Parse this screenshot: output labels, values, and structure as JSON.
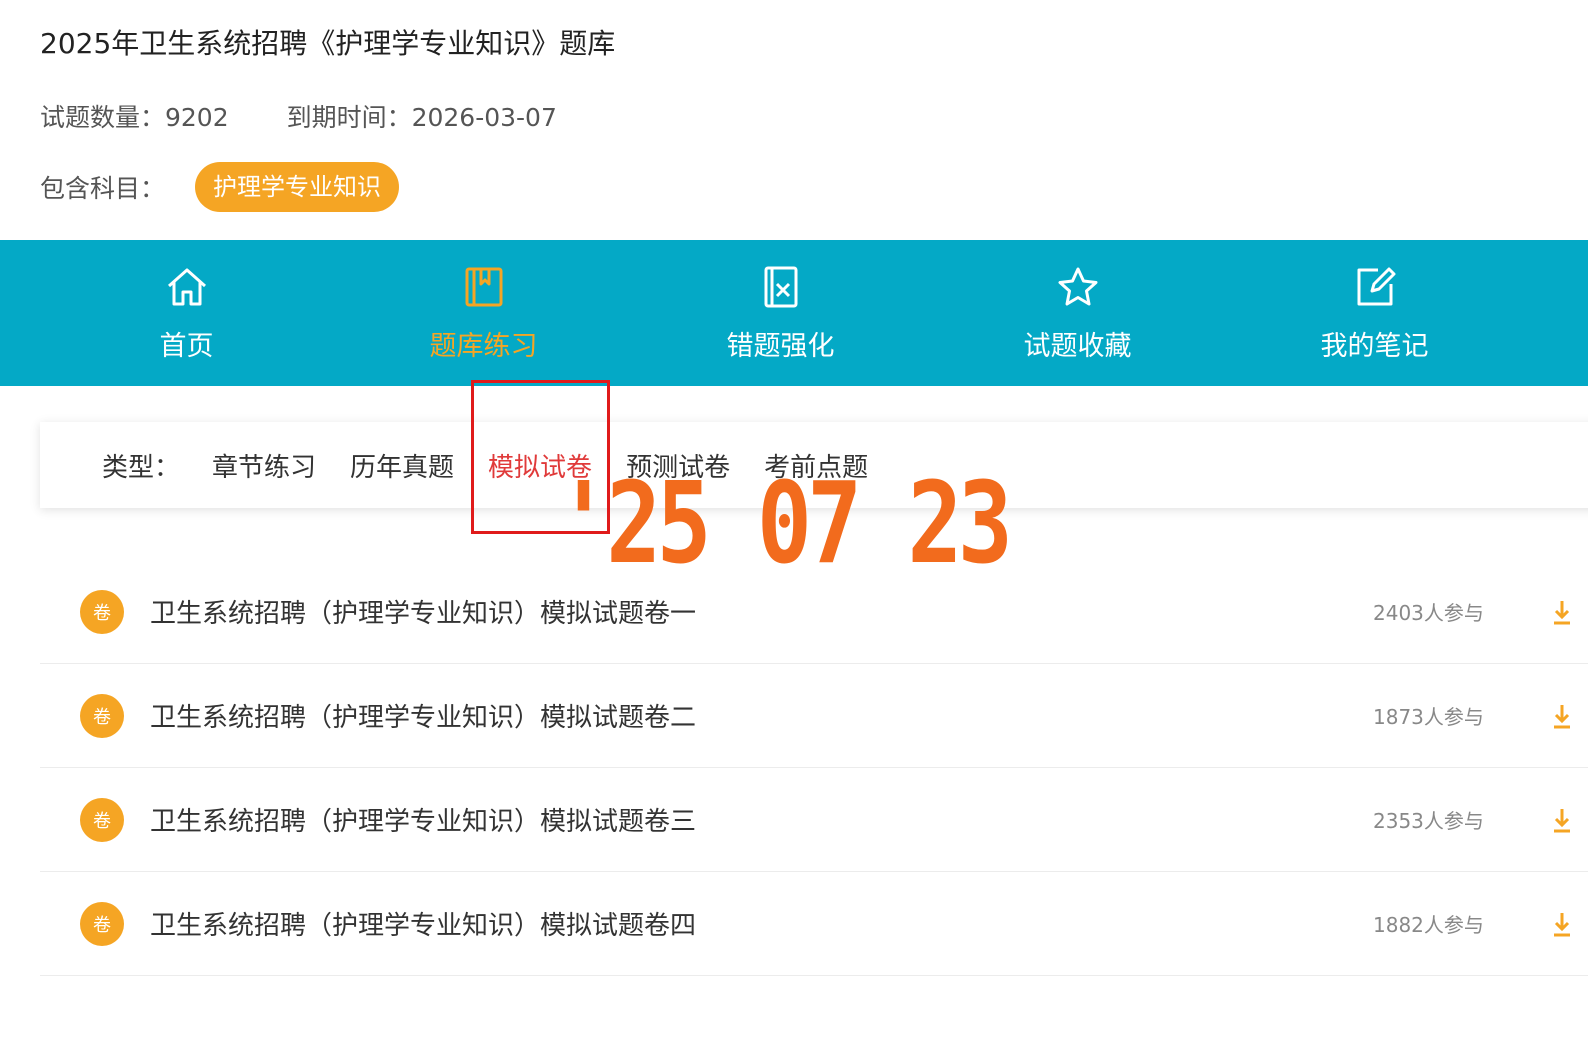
{
  "header": {
    "title": "2025年卫生系统招聘《护理学专业知识》题库",
    "question_count": "试题数量：9202",
    "expiry": "到期时间：2026-03-07",
    "subjects_label": "包含科目：",
    "subject_tag": "护理学专业知识"
  },
  "nav": [
    {
      "label": "首页",
      "icon": "home-icon"
    },
    {
      "label": "题库练习",
      "icon": "book-icon",
      "active": true
    },
    {
      "label": "错题强化",
      "icon": "wrong-question-icon"
    },
    {
      "label": "试题收藏",
      "icon": "star-icon"
    },
    {
      "label": "我的笔记",
      "icon": "edit-note-icon"
    }
  ],
  "filter": {
    "label": "类型：",
    "options": [
      "章节练习",
      "历年真题",
      "模拟试卷",
      "预测试卷",
      "考前点题"
    ],
    "active": "模拟试卷"
  },
  "stamp": "'25 07 23",
  "papers": [
    {
      "badge": "卷",
      "title": "卫生系统招聘（护理学专业知识）模拟试题卷一",
      "participants": "2403人参与"
    },
    {
      "badge": "卷",
      "title": "卫生系统招聘（护理学专业知识）模拟试题卷二",
      "participants": "1873人参与"
    },
    {
      "badge": "卷",
      "title": "卫生系统招聘（护理学专业知识）模拟试题卷三",
      "participants": "2353人参与"
    },
    {
      "badge": "卷",
      "title": "卫生系统招聘（护理学专业知识）模拟试题卷四",
      "participants": "1882人参与"
    }
  ],
  "colors": {
    "nav_bg": "#04a9c6",
    "accent_orange": "#f5a524",
    "active_red": "#e03a3a",
    "stamp_orange": "#f26b1d"
  }
}
